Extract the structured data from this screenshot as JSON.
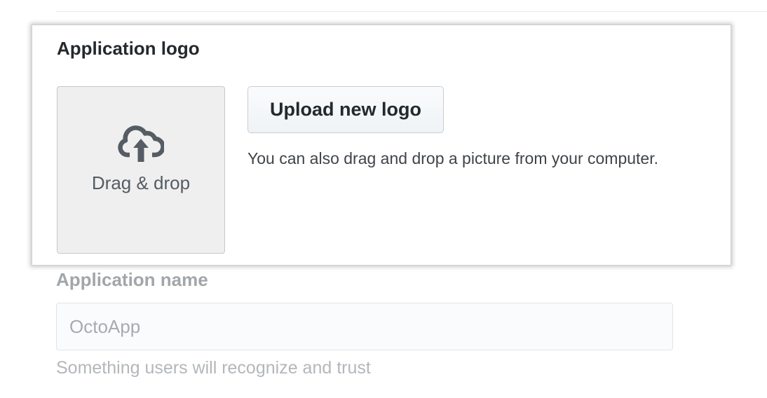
{
  "logo_section": {
    "title": "Application logo",
    "drop_zone_label": "Drag & drop",
    "upload_button_label": "Upload new logo",
    "upload_hint": "You can also drag and drop a picture from your computer.",
    "icon": "upload-cloud-icon"
  },
  "name_section": {
    "label": "Application name",
    "value": "OctoApp",
    "hint": "Something users will recognize and trust"
  },
  "colors": {
    "title_text": "#24292e",
    "drop_zone_bg": "#efefef",
    "icon_color": "#555c63",
    "muted_text": "#a2a6aa"
  }
}
